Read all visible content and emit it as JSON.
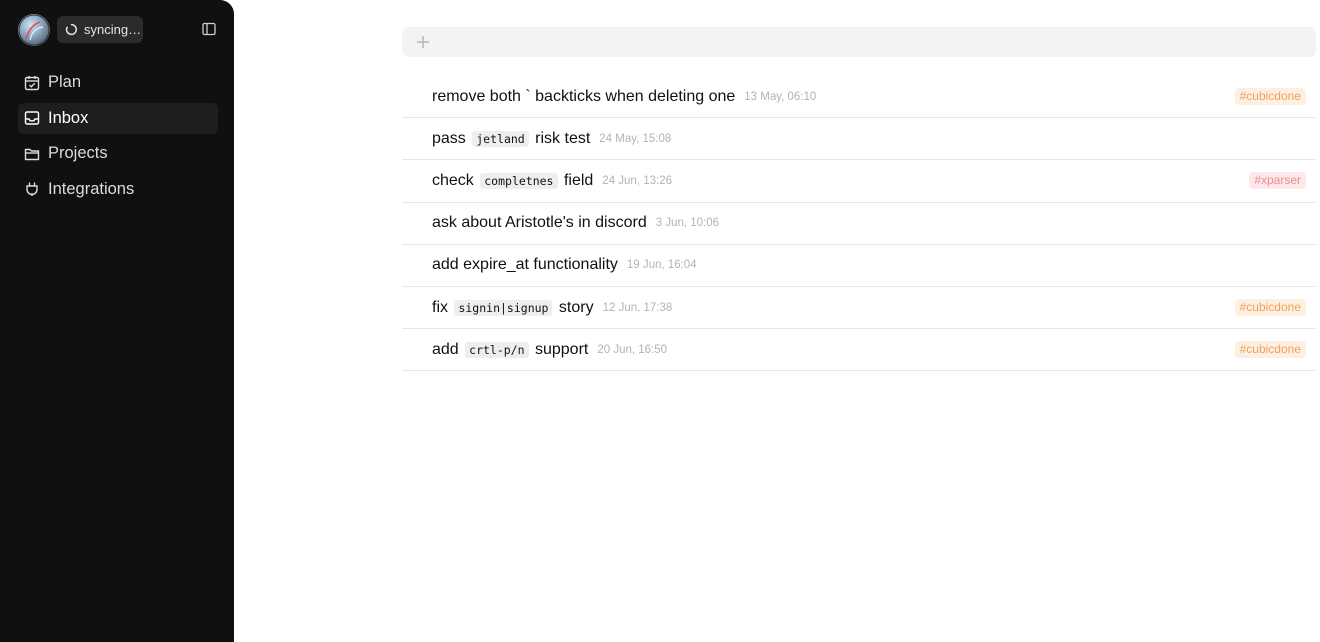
{
  "sidebar": {
    "sync_label": "syncing…",
    "nav": [
      {
        "label": "Plan",
        "icon": "calendar-check-icon",
        "active": false
      },
      {
        "label": "Inbox",
        "icon": "inbox-icon",
        "active": true
      },
      {
        "label": "Projects",
        "icon": "folder-icon",
        "active": false
      },
      {
        "label": "Integrations",
        "icon": "plug-icon",
        "active": false
      }
    ]
  },
  "add_bar": {
    "icon": "plus-icon"
  },
  "tasks": [
    {
      "parts": [
        "remove both ` backticks when deleting one"
      ],
      "code": [],
      "date": "13 May, 06:10",
      "tag": "#cubicdone",
      "tag_color": "orange"
    },
    {
      "parts": [
        "pass ",
        " risk test"
      ],
      "code": [
        "jetland"
      ],
      "date": "24 May, 15:08",
      "tag": "",
      "tag_color": ""
    },
    {
      "parts": [
        "check ",
        " field"
      ],
      "code": [
        "completnes"
      ],
      "date": "24 Jun, 13:26",
      "tag": "#xparser",
      "tag_color": "red"
    },
    {
      "parts": [
        "ask about Aristotle's in discord"
      ],
      "code": [],
      "date": "3 Jun, 10:06",
      "tag": "",
      "tag_color": ""
    },
    {
      "parts": [
        "add expire_at functionality"
      ],
      "code": [],
      "date": "19 Jun, 16:04",
      "tag": "",
      "tag_color": ""
    },
    {
      "parts": [
        "fix ",
        " story"
      ],
      "code": [
        "signin|signup"
      ],
      "date": "12 Jun, 17:38",
      "tag": "#cubicdone",
      "tag_color": "orange"
    },
    {
      "parts": [
        "add ",
        " support"
      ],
      "code": [
        "crtl-p/n"
      ],
      "date": "20 Jun, 16:50",
      "tag": "#cubicdone",
      "tag_color": "orange"
    }
  ],
  "colors": {
    "sidebar_bg": "#101010",
    "tag_orange_text": "#f2a05a",
    "tag_orange_bg": "#fdf0e2",
    "tag_red_text": "#ef8a97",
    "tag_red_bg": "#fde8ea"
  }
}
